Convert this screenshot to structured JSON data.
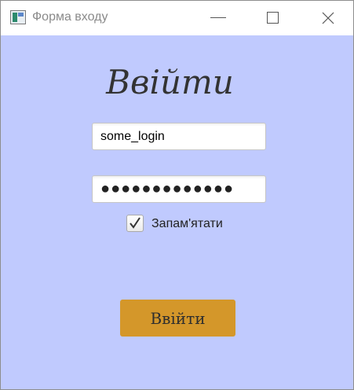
{
  "window": {
    "title": "Форма входу",
    "icon": "app-window-icon",
    "controls": [
      "minimize-icon",
      "maximize-icon",
      "close-icon"
    ],
    "background": "#c0cafe"
  },
  "form": {
    "heading": "Ввійти",
    "login_value": "some_login",
    "password_masked": "●●●●●●●●●●●●●",
    "remember_label": "Запам'ятати",
    "remember_checked": true,
    "submit_label": "Ввійти",
    "submit_color": "#d4972a"
  }
}
